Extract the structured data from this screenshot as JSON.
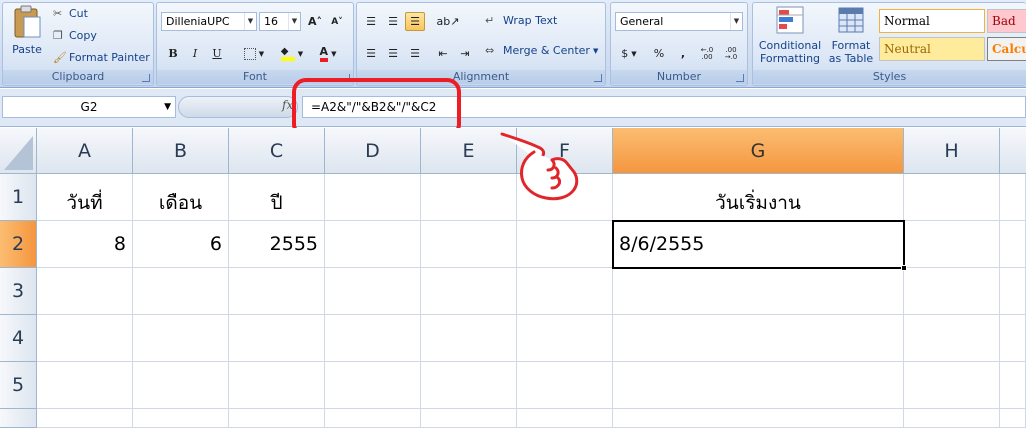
{
  "ribbon": {
    "clipboard": {
      "label": "Clipboard",
      "paste": "Paste",
      "cut": "Cut",
      "copy": "Copy",
      "format_painter": "Format Painter"
    },
    "font": {
      "label": "Font",
      "font_name": "DilleniaUPC",
      "font_size": "16",
      "bold": "B",
      "italic": "I",
      "underline": "U",
      "font_color_letter": "A"
    },
    "alignment": {
      "label": "Alignment",
      "wrap_text": "Wrap Text",
      "merge_center": "Merge & Center"
    },
    "number": {
      "label": "Number",
      "format": "General",
      "currency": "$",
      "percent": "%",
      "comma": ",",
      "inc_decimal": "←.0 .00",
      "dec_decimal": ".00 →.0"
    },
    "styles": {
      "label": "Styles",
      "conditional_formatting": "Conditional",
      "conditional_formatting_2": "Formatting",
      "format_as_table": "Format",
      "format_as_table_2": "as Table",
      "normal": "Normal",
      "bad": "Bad",
      "neutral": "Neutral",
      "calculation": "Calcula"
    }
  },
  "formula_bar": {
    "name_box": "G2",
    "fx": "fx",
    "formula": "=A2&\"/\"&B2&\"/\"&C2"
  },
  "columns": [
    "A",
    "B",
    "C",
    "D",
    "E",
    "F",
    "G",
    "H"
  ],
  "rows": [
    "1",
    "2",
    "3",
    "4",
    "5"
  ],
  "cells": {
    "A1": "วันที่",
    "B1": "เดือน",
    "C1": "ปี",
    "G1": "วันเริ่มงาน",
    "A2": "8",
    "B2": "6",
    "C2": "2555",
    "G2": "8/6/2555"
  },
  "colors": {
    "highlight": "#ee1c24",
    "selected_header": "#f5963f",
    "ribbon_bg": "#d1def0"
  }
}
